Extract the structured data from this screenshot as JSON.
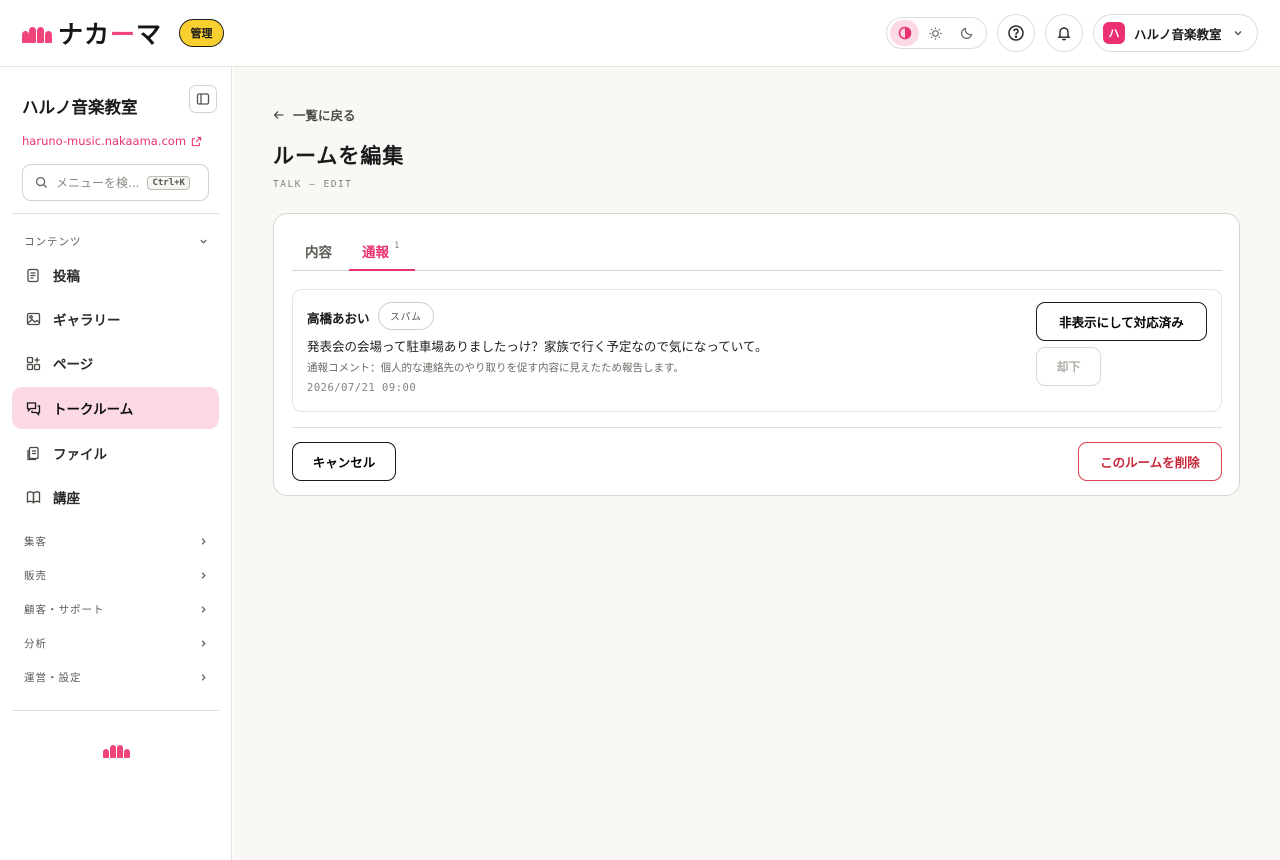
{
  "header": {
    "logo_text_a": "ナカ",
    "logo_text_accent": "ー",
    "logo_text_b": "マ",
    "admin_badge": "管理",
    "theme_options": [
      "contrast-icon",
      "sun-icon",
      "moon-icon"
    ],
    "account": {
      "avatar": "ハ",
      "name": "ハルノ音楽教室"
    }
  },
  "sidebar": {
    "org_name": "ハルノ音楽教室",
    "org_url": "haruno-music.nakaama.com",
    "search": {
      "placeholder": "メニューを検...",
      "shortcut": "Ctrl+K"
    },
    "content_section": "コンテンツ",
    "items": [
      {
        "label": "投稿",
        "icon": "document-icon"
      },
      {
        "label": "ギャラリー",
        "icon": "image-icon"
      },
      {
        "label": "ページ",
        "icon": "pages-icon"
      },
      {
        "label": "トークルーム",
        "icon": "chat-icon",
        "active": true
      },
      {
        "label": "ファイル",
        "icon": "files-icon"
      },
      {
        "label": "講座",
        "icon": "book-icon"
      }
    ],
    "sections": [
      "集客",
      "販売",
      "顧客・サポート",
      "分析",
      "運営・設定"
    ]
  },
  "main": {
    "back_label": "一覧に戻る",
    "title": "ルームを編集",
    "code": "TALK — EDIT",
    "tabs": [
      {
        "label": "内容"
      },
      {
        "label": "通報",
        "count": "1",
        "active": true
      }
    ],
    "report": {
      "author": "高橋あおい",
      "tag": "スパム",
      "message": "発表会の会場って駐車場ありましたっけ？家族で行く予定なので気になっていて。",
      "comment": "通報コメント：個人的な連絡先のやり取りを促す内容に見えたため報告します。",
      "date": "2026/07/21 09:00",
      "hide_button": "非表示にして対応済み",
      "dismiss_button": "却下"
    },
    "cancel_button": "キャンセル",
    "delete_button": "このルームを削除"
  },
  "colors": {
    "brand": "#f0457a",
    "accent": "#e8336e",
    "badge": "#f9cf2f",
    "danger": "#c8283a"
  }
}
